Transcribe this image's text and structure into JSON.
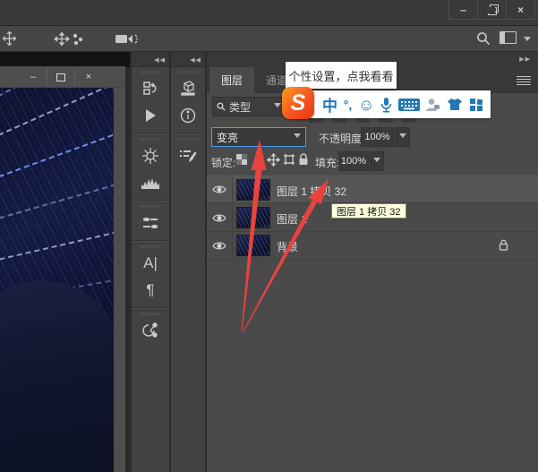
{
  "titlebar": {
    "minimize": "–",
    "close": "×"
  },
  "options_bar": {
    "left_icons": [
      "pan-cross-icon",
      "move-3d-icon",
      "video-camera-icon"
    ],
    "right_icons": [
      "search-icon",
      "workspace-switcher-icon",
      "chevron-down-icon"
    ]
  },
  "doc_window": {
    "minimize": "–",
    "close": "×"
  },
  "dock": {
    "collapse_glyph": "◀◀",
    "expand_glyph": "▶▶",
    "column1_icons": [
      "history-icon",
      "actions-play-icon",
      "wheel-icon",
      "histogram-icon",
      "brush-settings-icon",
      "character-panel-icon",
      "paragraph-panel-icon",
      "node-graph-icon"
    ],
    "column2_icons": [
      "3d-icon",
      "info-icon",
      "brush-presets-icon"
    ],
    "character_glyph": "A|",
    "paragraph_glyph": "¶"
  },
  "layers_panel": {
    "tabs": [
      {
        "label": "图层",
        "active": true
      },
      {
        "label": "通道",
        "active": false
      }
    ],
    "filter": {
      "type_label": "类型"
    },
    "blend_mode": {
      "value": "变亮"
    },
    "opacity": {
      "label": "不透明度:",
      "value": "100%"
    },
    "lock": {
      "label": "锁定:",
      "icons": [
        "lock-transparent-icon",
        "lock-paint-icon",
        "lock-move-icon",
        "lock-artboard-icon",
        "lock-all-icon"
      ]
    },
    "fill": {
      "label": "填充:",
      "value": "100%"
    },
    "layers": [
      {
        "name": "图层 1 拷贝 32",
        "selected": true,
        "visible": true,
        "locked": false
      },
      {
        "name": "图层 1",
        "selected": false,
        "visible": true,
        "locked": false
      },
      {
        "name": "背景",
        "selected": false,
        "visible": true,
        "locked": true
      }
    ]
  },
  "layer_tooltip": {
    "text": "图层 1 拷贝 32"
  },
  "ime_toolbar": {
    "bubble_text": "个性设置，点我看看",
    "logo_letter": "S",
    "lang_glyph": "中",
    "punct_glyph": "°,",
    "smiley_glyph": "☺",
    "icons": [
      "sogou-logo",
      "chinese-mode-icon",
      "punctuation-icon",
      "emoji-icon",
      "microphone-icon",
      "soft-keyboard-icon",
      "account-icon",
      "skin-shirt-icon",
      "toolbox-grid-icon"
    ]
  },
  "colors": {
    "accent_blue_border": "#4f9bf0",
    "ime_blue": "#2577b5",
    "logo_orange": "#f4511e",
    "arrow_red": "#e8433f",
    "tooltip_bg": "#ffffdf",
    "selected_row": "#555555",
    "panel_bg": "#4a4a4a"
  }
}
